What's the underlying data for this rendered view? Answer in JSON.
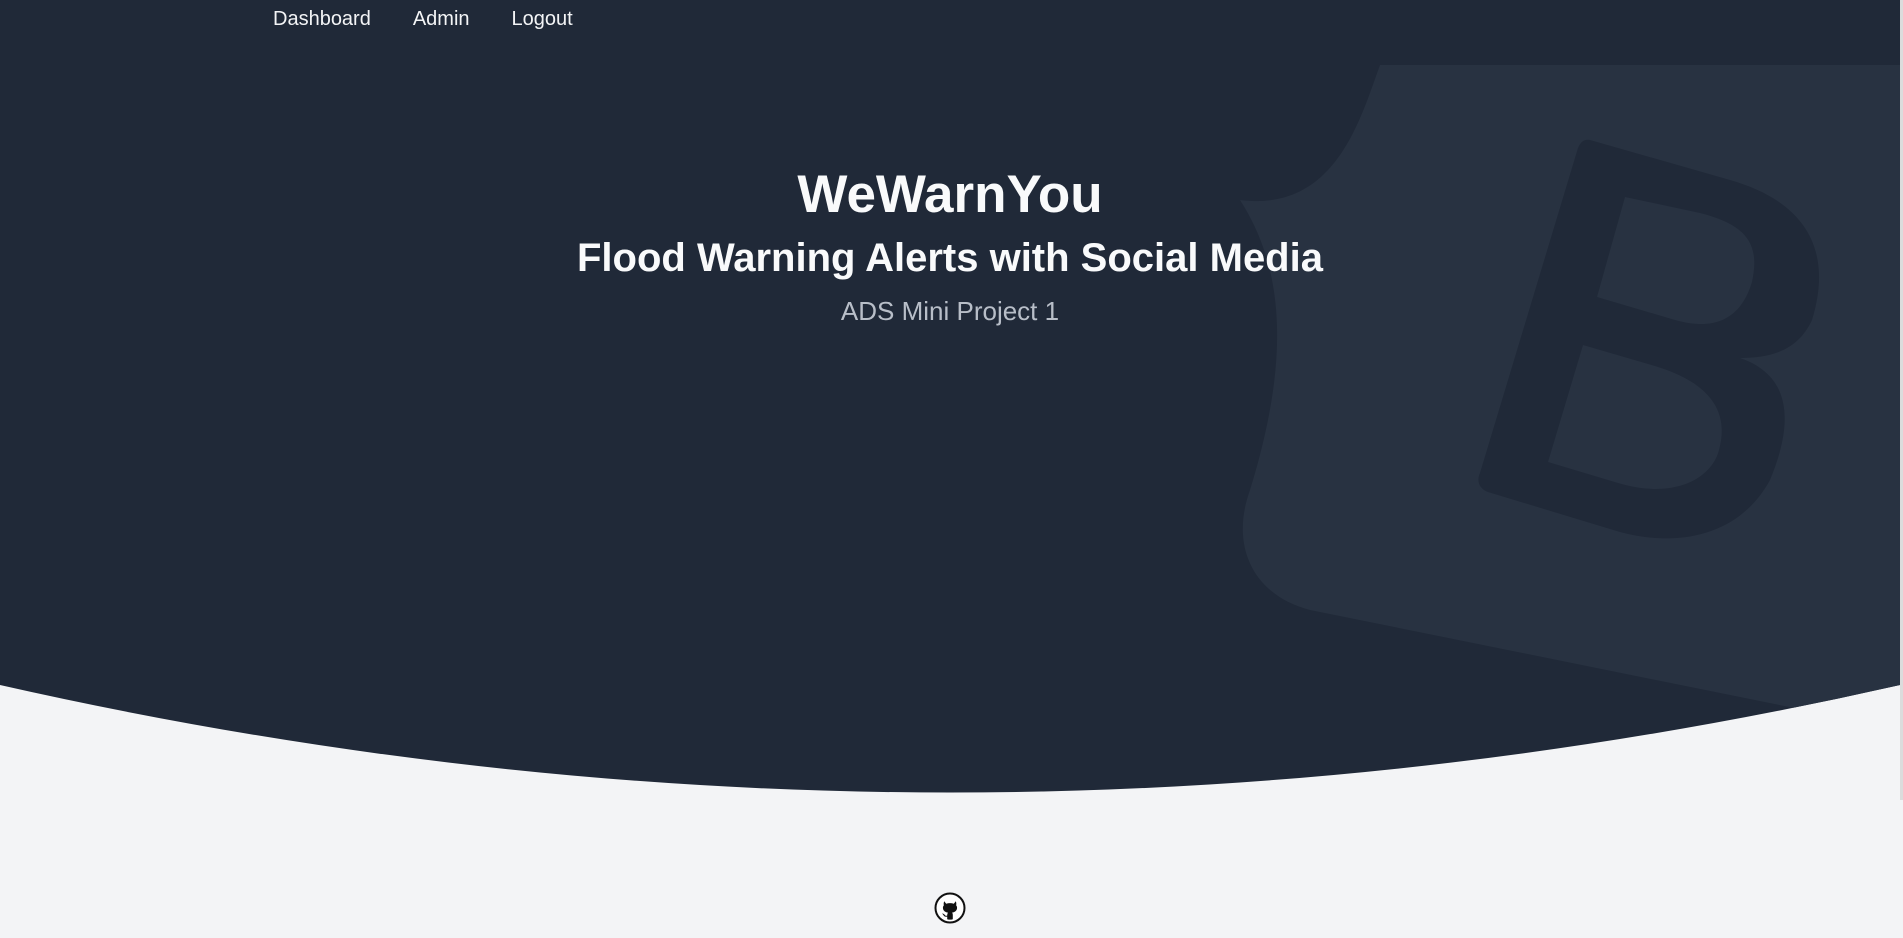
{
  "nav": {
    "items": [
      {
        "label": "Dashboard"
      },
      {
        "label": "Admin"
      },
      {
        "label": "Logout"
      }
    ]
  },
  "hero": {
    "title": "WeWarnYou",
    "subtitle": "Flood Warning Alerts with Social Media",
    "tagline": "ADS Mini Project 1"
  },
  "colors": {
    "hero_background": "#202938",
    "logo_shape": "#283241",
    "page_background": "#f3f4f6",
    "heading_text": "#f9fafb",
    "muted_text": "#b8bec8"
  },
  "icons": {
    "background_logo": "bootstrap-logo-icon",
    "footer": "github-icon"
  }
}
